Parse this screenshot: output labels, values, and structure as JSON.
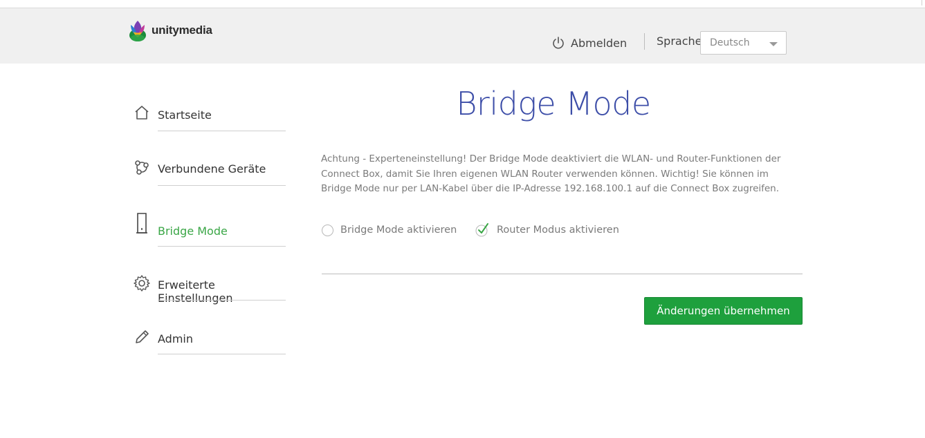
{
  "header": {
    "logo_text": "unitymedia",
    "logout_label": "Abmelden",
    "language_label": "Sprache",
    "language_selected": "Deutsch"
  },
  "sidebar": {
    "items": [
      {
        "label": "Startseite",
        "icon": "home-icon",
        "active": false
      },
      {
        "label": "Verbundene Geräte",
        "icon": "devices-icon",
        "active": false
      },
      {
        "label": "Bridge Mode",
        "icon": "router-icon",
        "active": true
      },
      {
        "label": "Erweiterte Einstellungen",
        "icon": "gear-icon",
        "active": false
      },
      {
        "label": "Admin",
        "icon": "pencil-icon",
        "active": false
      }
    ]
  },
  "main": {
    "title": "Bridge Mode",
    "description": "Achtung - Experteneinstellung! Der Bridge Mode deaktiviert die WLAN- und Router-Funktionen der Connect Box, damit Sie Ihren eigenen WLAN Router verwenden können. Wichtig! Sie können im Bridge Mode nur per LAN-Kabel über die IP-Adresse 192.168.100.1 auf die Connect Box zugreifen.",
    "options": [
      {
        "label": "Bridge Mode aktivieren",
        "selected": false
      },
      {
        "label": "Router Modus aktivieren",
        "selected": true
      }
    ],
    "apply_label": "Änderungen übernehmen"
  },
  "colors": {
    "active_nav": "#3aa646",
    "title": "#3d4ea8",
    "apply_button": "#1ea03d",
    "check": "#3aa646"
  }
}
